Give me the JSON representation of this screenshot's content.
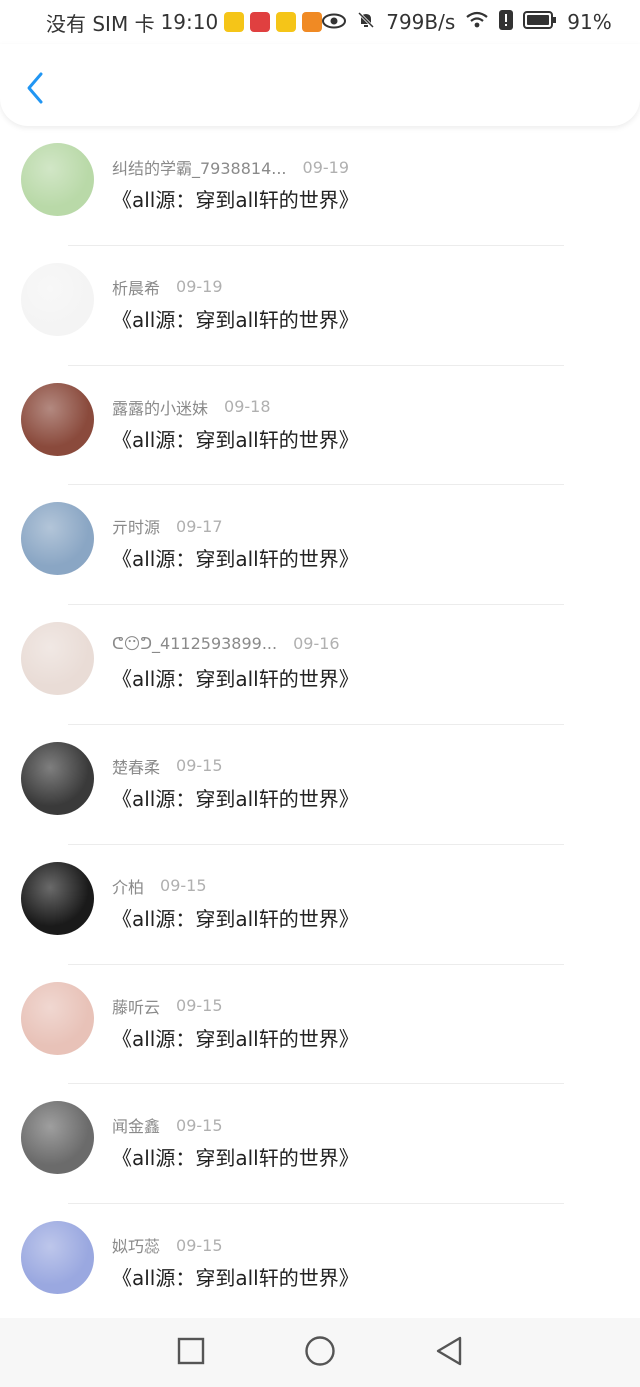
{
  "status_bar": {
    "carrier": "没有 SIM 卡",
    "time": "19:10",
    "speed": "799B/s",
    "battery": "91%",
    "icons": [
      "weibo-icon",
      "huawei-icon",
      "weibo-icon",
      "play-icon",
      "eye-icon",
      "bell-off-icon",
      "wifi-icon",
      "alert-icon",
      "battery-icon"
    ]
  },
  "header": {
    "back_icon": "chevron-left-icon",
    "accent": "#2196f3"
  },
  "items": [
    {
      "name": "纠结的学霸_7938814...",
      "date": "09-19",
      "title": "《all源：穿到all轩的世界》",
      "avatar_color": "#b9d9a8"
    },
    {
      "name": "析晨希",
      "date": "09-19",
      "title": "《all源：穿到all轩的世界》",
      "avatar_color": "#f4f4f4"
    },
    {
      "name": "露露的小迷妹",
      "date": "09-18",
      "title": "《all源：穿到all轩的世界》",
      "avatar_color": "#8a4a3c"
    },
    {
      "name": "亓时源",
      "date": "09-17",
      "title": "《all源：穿到all轩的世界》",
      "avatar_color": "#8aa6c4"
    },
    {
      "name": "ᕦ😶ᕤ_4112593899...",
      "date": "09-16",
      "title": "《all源：穿到all轩的世界》",
      "avatar_color": "#e9dcd6"
    },
    {
      "name": "楚春柔",
      "date": "09-15",
      "title": "《all源：穿到all轩的世界》",
      "avatar_color": "#3a3a3a"
    },
    {
      "name": "介柏",
      "date": "09-15",
      "title": "《all源：穿到all轩的世界》",
      "avatar_color": "#1a1a1a"
    },
    {
      "name": "藤听云",
      "date": "09-15",
      "title": "《all源：穿到all轩的世界》",
      "avatar_color": "#e8c2b8"
    },
    {
      "name": "闻金鑫",
      "date": "09-15",
      "title": "《all源：穿到all轩的世界》",
      "avatar_color": "#6b6b6b"
    },
    {
      "name": "姒巧蕊",
      "date": "09-15",
      "title": "《all源：穿到all轩的世界》",
      "avatar_color": "#9aa8e0"
    }
  ],
  "nav_bar": {
    "icons": [
      "square-icon",
      "circle-icon",
      "triangle-back-icon"
    ]
  }
}
